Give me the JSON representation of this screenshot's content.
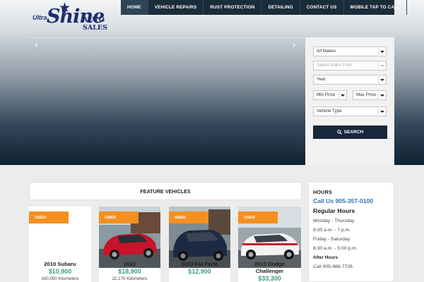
{
  "brand": {
    "logo_ultra": "Ultra",
    "logo_shine": "Shine",
    "logo_sales": "AUTO SALES"
  },
  "nav": {
    "items": [
      {
        "label": "HOME"
      },
      {
        "label": "VEHICLE REPAIRS"
      },
      {
        "label": "RUST PROTECTION"
      },
      {
        "label": "DETAILING"
      },
      {
        "label": "CONTACT US"
      },
      {
        "label": "MOBILE TAP TO CALL"
      }
    ]
  },
  "search": {
    "makes": "All Makes",
    "model": "Select Make First!",
    "year": "Year",
    "min_price": "Min Price",
    "max_price": "Max Price",
    "vehicle_type": "Vehicle Type",
    "button": "SEARCH"
  },
  "feature": {
    "title": "FEATURE VEHICLES",
    "vehicles": [
      {
        "tag": "USED",
        "title": "2010 Subaru",
        "price": "$10,900",
        "km": "160,000 Kilometers"
      },
      {
        "tag": "USED",
        "title": "2013",
        "price": "$18,900",
        "km": "22,170 Kilometers"
      },
      {
        "tag": "USED",
        "title": "2013 Kia Forte",
        "price": "$12,900",
        "km": ""
      },
      {
        "tag": "USED",
        "title": "2013 Dodge",
        "title2": "Challenger",
        "price": "$33,300",
        "km": ""
      }
    ]
  },
  "hours": {
    "title": "HOURS",
    "call": "Call Us 905-357-0100",
    "regular_title": "Regular Hours",
    "weekday_label": "Monday - Thursday",
    "weekday_hours": "8:30 a.m. - 7 p.m.",
    "weekend_label": "Friday - Saturday",
    "weekend_hours": "8:30 a.m. - 5:00 p.m.",
    "after_title": "After Hours",
    "after_call": "Call 905-988-7726"
  },
  "colors": {
    "nav_bg": "#1b2c3b",
    "accent_orange": "#f39020",
    "price_green": "#3a9c87",
    "link_blue": "#2c73b8",
    "button_dark": "#17283a"
  }
}
